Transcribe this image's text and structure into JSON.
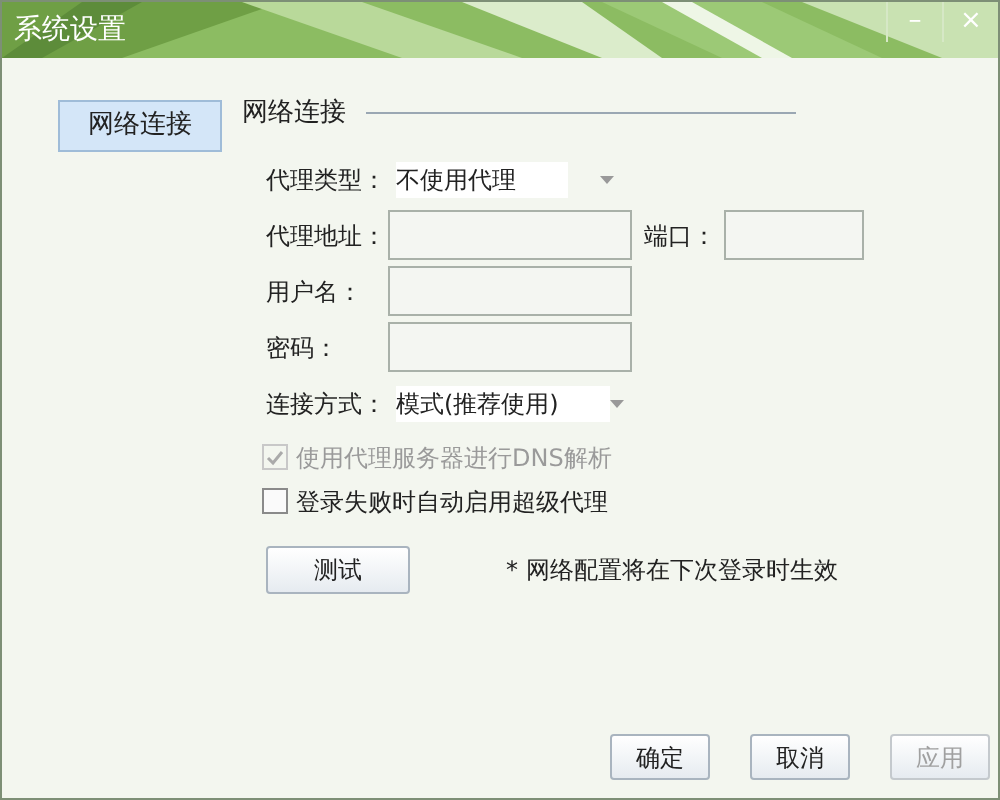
{
  "window": {
    "title": "系统设置",
    "controls": [
      "–",
      "×"
    ]
  },
  "sidebar": {
    "items": [
      {
        "label": "网络连接",
        "selected": true
      }
    ]
  },
  "section": {
    "title": "网络连接"
  },
  "form": {
    "rows": [
      {
        "kind": "select",
        "label": "代理类型：",
        "value": "不使用代理"
      },
      {
        "kind": "input",
        "label": "代理地址：",
        "extra_label": "端口："
      },
      {
        "kind": "input",
        "label": "用户名："
      },
      {
        "kind": "input",
        "label": "密码："
      },
      {
        "kind": "select",
        "label": "连接方式：",
        "value": "模式(推荐使用)"
      }
    ]
  },
  "checkboxes": [
    {
      "label": "使用代理服务器进行DNS解析",
      "checked": true,
      "disabled": true
    },
    {
      "label": "登录失败时自动启用超级代理",
      "checked": false,
      "disabled": false
    }
  ],
  "test_button": "测试",
  "note": "* 网络配置将在下次登录时生效",
  "buttons": [
    {
      "label": "确定",
      "disabled": false
    },
    {
      "label": "取消",
      "disabled": false
    },
    {
      "label": "应用",
      "disabled": true
    }
  ]
}
